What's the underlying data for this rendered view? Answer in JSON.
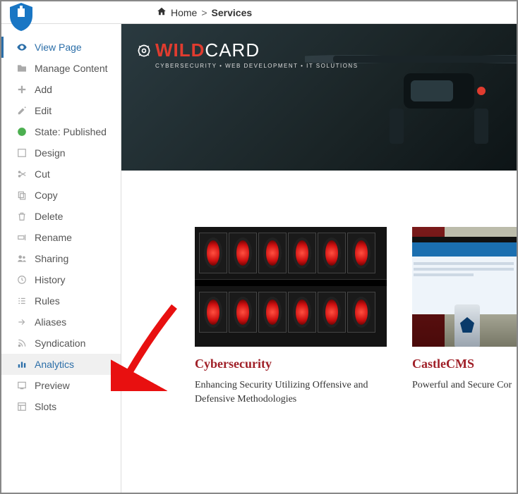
{
  "breadcrumb": {
    "home": "Home",
    "sep": ">",
    "current": "Services"
  },
  "sidebar": {
    "items": [
      {
        "label": "View Page"
      },
      {
        "label": "Manage Content"
      },
      {
        "label": "Add"
      },
      {
        "label": "Edit"
      },
      {
        "label": "State: Published"
      },
      {
        "label": "Design"
      },
      {
        "label": "Cut"
      },
      {
        "label": "Copy"
      },
      {
        "label": "Delete"
      },
      {
        "label": "Rename"
      },
      {
        "label": "Sharing"
      },
      {
        "label": "History"
      },
      {
        "label": "Rules"
      },
      {
        "label": "Aliases"
      },
      {
        "label": "Syndication"
      },
      {
        "label": "Analytics"
      },
      {
        "label": "Preview"
      },
      {
        "label": "Slots"
      }
    ]
  },
  "brand": {
    "wild": "WILD",
    "card": "CARD",
    "tagline": "CYBERSECURITY • WEB DEVELOPMENT • IT SOLUTIONS"
  },
  "services": [
    {
      "title": "Cybersecurity",
      "desc": "Enhancing Security Utilizing Offensive and Defensive Methodologies"
    },
    {
      "title": "CastleCMS",
      "desc": "Powerful and Secure Cor"
    }
  ]
}
